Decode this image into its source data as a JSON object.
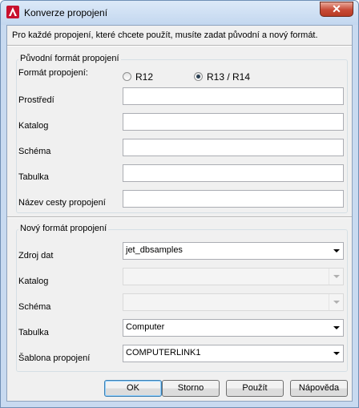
{
  "window": {
    "title": "Konverze propojení",
    "close_glyph": "✕"
  },
  "description": "Pro každé propojení, které chcete použít, musíte zadat původní a nový formát.",
  "original_group": {
    "title": "Původní formát propojení",
    "format_label": "Formát propojení:",
    "radio_r12": {
      "label": "R12",
      "selected": false
    },
    "radio_r13": {
      "label": "R13 / R14",
      "selected": true
    },
    "fields": [
      {
        "label": "Prostředí",
        "value": ""
      },
      {
        "label": "Katalog",
        "value": ""
      },
      {
        "label": "Schéma",
        "value": ""
      },
      {
        "label": "Tabulka",
        "value": ""
      },
      {
        "label": "Název cesty propojení",
        "value": ""
      }
    ]
  },
  "new_group": {
    "title": "Nový formát propojení",
    "fields": [
      {
        "label": "Zdroj dat",
        "value": "jet_dbsamples",
        "enabled": true
      },
      {
        "label": "Katalog",
        "value": "",
        "enabled": false
      },
      {
        "label": "Schéma",
        "value": "",
        "enabled": false
      },
      {
        "label": "Tabulka",
        "value": "Computer",
        "enabled": true
      },
      {
        "label": "Šablona propojení",
        "value": "COMPUTERLINK1",
        "enabled": true
      }
    ]
  },
  "buttons": {
    "ok": "OK",
    "cancel": "Storno",
    "apply": "Použít",
    "help": "Nápověda"
  },
  "colors": {
    "app_icon": "#c8102e",
    "title_bar": "#c3d7ef",
    "close_button": "#c74a36"
  },
  "icons": {
    "app": "autocad-icon",
    "close": "close-icon",
    "dropdown": "chevron-down-icon"
  }
}
